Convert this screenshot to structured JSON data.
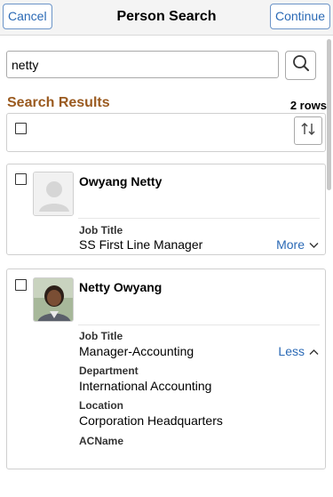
{
  "header": {
    "cancel_label": "Cancel",
    "title": "Person Search",
    "continue_label": "Continue"
  },
  "search": {
    "value": "netty"
  },
  "results": {
    "title": "Search Results",
    "rows_count": "2 rows"
  },
  "people": [
    {
      "name": "Owyang Netty",
      "fields": [
        {
          "label": "Job Title",
          "value": "SS First Line Manager"
        }
      ],
      "toggle_label": "More"
    },
    {
      "name": "Netty Owyang",
      "fields": [
        {
          "label": "Job Title",
          "value": "Manager-Accounting"
        },
        {
          "label": "Department",
          "value": "International Accounting"
        },
        {
          "label": "Location",
          "value": "Corporation Headquarters"
        },
        {
          "label": "ACName",
          "value": ""
        }
      ],
      "toggle_label": "Less"
    }
  ],
  "colors": {
    "accent": "#2a69b5",
    "section_title": "#9a5a1f"
  },
  "icons": {
    "search": "search-icon",
    "sort": "sort-icon",
    "chevron_down": "chevron-down-icon",
    "chevron_up": "chevron-up-icon"
  }
}
